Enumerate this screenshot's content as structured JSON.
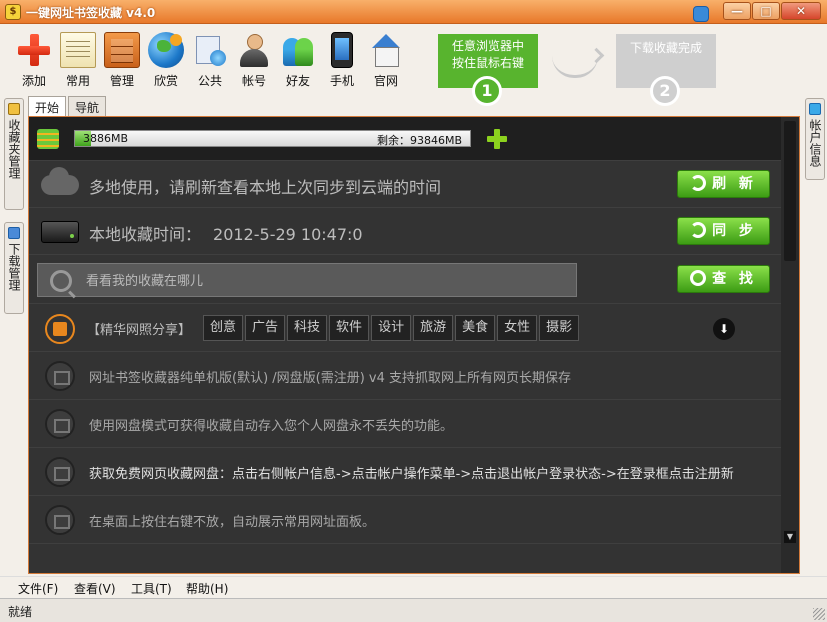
{
  "window": {
    "title": "一键网址书签收藏 v4.0",
    "minimize": "—",
    "maximize": "□",
    "close": "✕"
  },
  "toolbar": {
    "items": [
      {
        "label": "添加",
        "icon": "add-icon"
      },
      {
        "label": "常用",
        "icon": "notepad-icon"
      },
      {
        "label": "管理",
        "icon": "cabinet-icon"
      },
      {
        "label": "欣赏",
        "icon": "globe-icon"
      },
      {
        "label": "公共",
        "icon": "public-icon"
      },
      {
        "label": "帐号",
        "icon": "user-icon"
      },
      {
        "label": "好友",
        "icon": "friends-icon"
      },
      {
        "label": "手机",
        "icon": "phone-icon"
      },
      {
        "label": "官网",
        "icon": "home-icon"
      }
    ],
    "tip1": "任意浏览器中\n按住鼠标右键",
    "tip1_line1": "任意浏览器中",
    "tip1_line2": "按住鼠标右键",
    "tip1_num": "1",
    "tip2": "下载收藏完成",
    "tip2_num": "2"
  },
  "tabs": [
    {
      "label": "开始"
    },
    {
      "label": "导航"
    }
  ],
  "side_left": [
    {
      "label": "收藏夹管理"
    },
    {
      "label": "下载管理"
    }
  ],
  "side_right": [
    {
      "label": "帐户信息"
    }
  ],
  "storage": {
    "used": "3886MB",
    "free": "剩余：93846MB",
    "used_fraction": 0.04
  },
  "sync": {
    "message": "多地使用，请刷新查看本地上次同步到云端的时间",
    "refresh_label": "刷 新",
    "local_label": "本地收藏时间：",
    "local_time": "2012-5-29 10:47:0",
    "sync_label": "同 步"
  },
  "search": {
    "placeholder": "看看我的收藏在哪儿",
    "button_label": "查 找"
  },
  "categories": {
    "title": "【精华网照分享】",
    "items": [
      "创意",
      "广告",
      "科技",
      "软件",
      "设计",
      "旅游",
      "美食",
      "女性",
      "摄影"
    ]
  },
  "news": [
    "网址书签收藏器纯单机版(默认) /网盘版(需注册) v4 支持抓取网上所有网页长期保存",
    "使用网盘模式可获得收藏自动存入您个人网盘永不丢失的功能。",
    "获取免费网页收藏网盘：点击右侧帐户信息->点击帐户操作菜单->点击退出帐户登录状态->在登录框点击注册新",
    "在桌面上按住右键不放，自动展示常用网址面板。"
  ],
  "menu": [
    {
      "label": "文件(F)"
    },
    {
      "label": "查看(V)"
    },
    {
      "label": "工具(T)"
    },
    {
      "label": "帮助(H)"
    }
  ],
  "status": {
    "text": "就绪"
  }
}
